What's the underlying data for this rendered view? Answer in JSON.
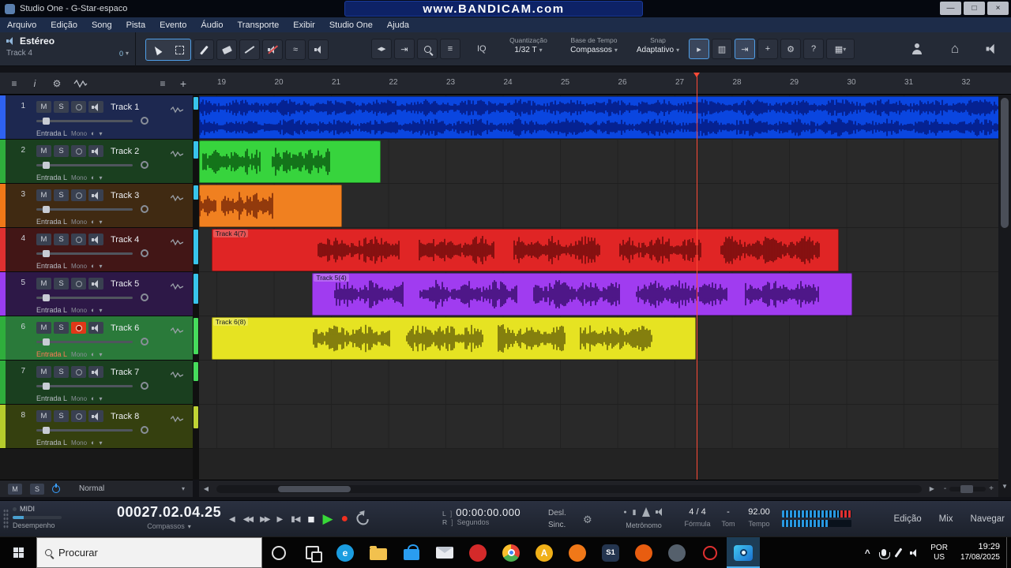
{
  "window": {
    "title": "Studio One - G-Star-espaco",
    "watermark": "www.BANDICAM.com"
  },
  "glyphs": {
    "min": "—",
    "max": "□",
    "close": "×",
    "chev": "▾",
    "hamburger": "≡",
    "info": "i",
    "list": "≡",
    "plus": "+",
    "minus": "-",
    "left": "◀",
    "right": "▶",
    "up": "▲",
    "down": "▼",
    "prev": "◀",
    "rew": "◀◀",
    "fwd": "▶▶",
    "next": "▶",
    "tostart": "▮◀",
    "stop": "■",
    "play": "▶",
    "rec": "●",
    "bracket": "]",
    "gear": "⚙",
    "help": "?",
    "home": "⌂",
    "grid": "▦",
    "vgrid": "▥",
    "flag": "▸",
    "tab": "⇥",
    "wave": "≈",
    "mono": "◐",
    "caret": "^",
    "arrows": "◀▶",
    "dot": "●",
    "bar": "▮"
  },
  "menu": [
    "Arquivo",
    "Edição",
    "Song",
    "Pista",
    "Evento",
    "Áudio",
    "Transporte",
    "Exibir",
    "Studio One",
    "Ajuda"
  ],
  "toolbar": {
    "channel": "Estéreo",
    "track": "Track 4",
    "count": "0",
    "iq": "IQ",
    "quantize_label": "Quantização",
    "quantize_value": "1/32 T",
    "timebase_label": "Base de Tempo",
    "timebase_value": "Compassos",
    "snap_label": "Snap",
    "snap_value": "Adaptativo"
  },
  "ruler": {
    "first_bar": 19,
    "last_bar": 32
  },
  "playhead_bar": 27.37,
  "track_labels": {
    "mute": "M",
    "solo": "S",
    "input": "Entrada L",
    "mode": "Mono"
  },
  "tracks": [
    {
      "num": "1",
      "name": "Track 1",
      "strip": "#2e62f2",
      "bg": "#1d2850",
      "rec": false
    },
    {
      "num": "2",
      "name": "Track 2",
      "strip": "#2fae3c",
      "bg": "#1a3f1f",
      "rec": false
    },
    {
      "num": "3",
      "name": "Track 3",
      "strip": "#f07818",
      "bg": "#402a12",
      "rec": false
    },
    {
      "num": "4",
      "name": "Track 4",
      "strip": "#e03030",
      "bg": "#421616",
      "rec": false
    },
    {
      "num": "5",
      "name": "Track 5",
      "strip": "#9a3df0",
      "bg": "#2d1847",
      "rec": false
    },
    {
      "num": "6",
      "name": "Track 6",
      "strip": "#2fae3c",
      "bg": "#2a7a3a",
      "rec": true
    },
    {
      "num": "7",
      "name": "Track 7",
      "strip": "#2fae3c",
      "bg": "#1a3f1f",
      "rec": false
    },
    {
      "num": "8",
      "name": "Track 8",
      "strip": "#b6cc2c",
      "bg": "#35400f",
      "rec": false
    }
  ],
  "clips": [
    {
      "track": 1,
      "label": "",
      "start_bar": 18.68,
      "end_bar": 32.7,
      "bg": "#0a46e0",
      "wave": "#041a7e",
      "channels": 2,
      "bursts": [
        [
          0,
          1
        ]
      ],
      "seed": 11
    },
    {
      "track": 2,
      "label": "",
      "start_bar": 18.68,
      "end_bar": 21.85,
      "bg": "#37d43d",
      "wave": "#0b5c12",
      "channels": 1,
      "bursts": [
        [
          0.02,
          0.34
        ],
        [
          0.4,
          0.72
        ]
      ],
      "seed": 22
    },
    {
      "track": 3,
      "label": "",
      "start_bar": 18.68,
      "end_bar": 21.18,
      "bg": "#f08020",
      "wave": "#7a2808",
      "channels": 1,
      "bursts": [
        [
          0.0,
          0.12
        ],
        [
          0.16,
          0.52
        ]
      ],
      "seed": 33
    },
    {
      "track": 4,
      "label": "Track 4(7)",
      "start_bar": 18.9,
      "end_bar": 29.85,
      "bg": "#e02525",
      "wave": "#700c0c",
      "channels": 1,
      "bursts": [
        [
          0.17,
          0.3
        ],
        [
          0.33,
          0.45
        ],
        [
          0.48,
          0.62
        ],
        [
          0.65,
          0.78
        ],
        [
          0.81,
          0.97
        ]
      ],
      "seed": 44
    },
    {
      "track": 5,
      "label": "Track 5(4)",
      "start_bar": 20.66,
      "end_bar": 30.1,
      "bg": "#a03cf0",
      "wave": "#3a0e6e",
      "channels": 1,
      "bursts": [
        [
          0.04,
          0.17
        ],
        [
          0.2,
          0.38
        ],
        [
          0.41,
          0.57
        ],
        [
          0.6,
          0.77
        ],
        [
          0.8,
          0.94
        ]
      ],
      "seed": 55
    },
    {
      "track": 6,
      "label": "Track 6(8)",
      "start_bar": 18.9,
      "end_bar": 27.35,
      "bg": "#e6e322",
      "wave": "#6b660a",
      "channels": 1,
      "bursts": [
        [
          0.21,
          0.37
        ],
        [
          0.4,
          0.56
        ],
        [
          0.59,
          0.73
        ],
        [
          0.76,
          0.91
        ]
      ],
      "seed": 66
    }
  ],
  "arrange_footer": {
    "mute": "M",
    "solo": "S",
    "mode": "Normal"
  },
  "transport": {
    "midi": "MIDI",
    "performance": "Desempenho",
    "time_main": "00027.02.04.25",
    "time_main_unit": "Compassos",
    "time_secondary": "00:00:00.000",
    "time_secondary_unit": "Segundos",
    "left": "L",
    "right": "R",
    "offline": "Desl.",
    "sync": "Sinc.",
    "metronome": "Metrônomo",
    "signature_value": "4 / 4",
    "signature_label": "Fórmula",
    "key_value": "-",
    "key_label": "Tom",
    "tempo_value": "92.00",
    "tempo_label": "Tempo",
    "views": {
      "edit": "Edição",
      "mix": "Mix",
      "browse": "Navegar"
    }
  },
  "taskbar": {
    "search_placeholder": "Procurar",
    "lang_top": "POR",
    "lang_bottom": "US",
    "time": "19:29",
    "date": "17/08/2025",
    "apps": [
      {
        "name": "cortana-icon",
        "type": "ring",
        "color": "#e0e0e0"
      },
      {
        "name": "task-view-icon",
        "type": "taskview"
      },
      {
        "name": "edge-icon",
        "type": "circle",
        "color": "#1b9de0",
        "glyph": "e"
      },
      {
        "name": "file-explorer-icon",
        "type": "folder",
        "color": "#f2c14e"
      },
      {
        "name": "store-icon",
        "type": "bag",
        "color": "#2a9df0"
      },
      {
        "name": "mail-icon",
        "type": "envelope"
      },
      {
        "name": "security-icon",
        "type": "circle",
        "color": "#d42a2a"
      },
      {
        "name": "chrome-icon",
        "type": "chrome"
      },
      {
        "name": "amber-app-icon",
        "type": "circle",
        "color": "#f0b018",
        "glyph": "A"
      },
      {
        "name": "orange-app-icon",
        "type": "circle",
        "color": "#f07818"
      },
      {
        "name": "studio-one-icon",
        "type": "square",
        "color": "#24354f",
        "glyph": "S1"
      },
      {
        "name": "firefox-icon",
        "type": "circle",
        "color": "#e85d10"
      },
      {
        "name": "media-app-icon",
        "type": "circle",
        "color": "#55606c"
      },
      {
        "name": "record-app-icon",
        "type": "ring",
        "color": "#e03030"
      },
      {
        "name": "bandicam-icon",
        "type": "camera",
        "active": true
      }
    ]
  }
}
